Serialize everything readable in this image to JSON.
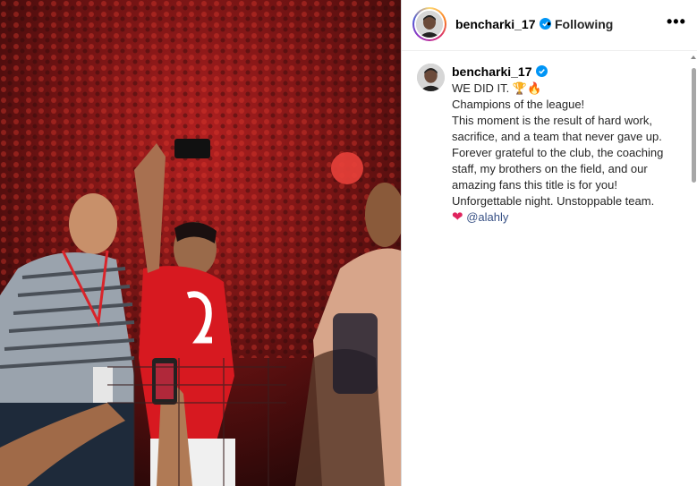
{
  "post": {
    "username": "bencharki_17",
    "separator": "•",
    "follow_status": "Following",
    "more_label": "•••"
  },
  "caption": {
    "username": "bencharki_17",
    "line1": "WE DID IT.",
    "line1_emojis": "🏆🔥",
    "line2": "Champions of the league!",
    "line3": "This moment is the result of hard work, sacrifice, and a team that never gave up.",
    "line4": "Forever grateful to the club, the coaching staff, my brothers on the field, and our amazing fans this title is for you!",
    "line5": "Unforgettable night. Unstoppable team.",
    "heart": "❤",
    "mention": "@alahly"
  },
  "colors": {
    "verified": "#0095f6",
    "mention": "#385185",
    "jersey": "#d71920"
  }
}
